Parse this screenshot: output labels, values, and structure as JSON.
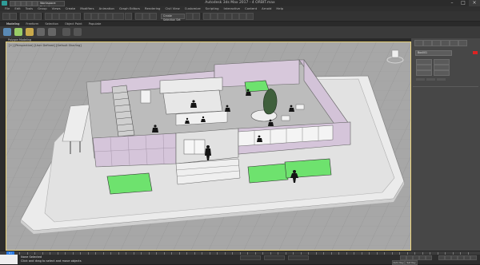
{
  "window": {
    "title": "Autodesk 3ds Max 2017 - 4 ORBIT.max",
    "workspace": "Workspace: Default"
  },
  "menu": [
    "File",
    "Edit",
    "Tools",
    "Group",
    "Views",
    "Create",
    "Modifiers",
    "Animation",
    "Graph Editors",
    "Rendering",
    "Civil View",
    "Customize",
    "Scripting",
    "Interactive",
    "Content",
    "Arnold",
    "Help"
  ],
  "toolbar": {
    "selection_dropdown": "Create Selection Set"
  },
  "ribbon": {
    "tabs": [
      "Modeling",
      "Freeform",
      "Selection",
      "Object Paint",
      "Populate"
    ],
    "panel_label": "Polygon Modeling"
  },
  "viewport": {
    "label": "[+] [Perspective] [User Defined] [Default Shading]"
  },
  "command_panel": {
    "object_name": "Box001"
  },
  "status": {
    "line1": "None Selected",
    "line2": "Click and drag to select and move objects",
    "autokey": "Auto Key",
    "setkey": "Set Key"
  },
  "timeline": {
    "frame": "0 / 100"
  },
  "colors": {
    "accent": "#2f9c98",
    "viewport_bg": "#a7a7a7",
    "wall": "#d3c3d8",
    "green_box": "#6ee26e"
  }
}
